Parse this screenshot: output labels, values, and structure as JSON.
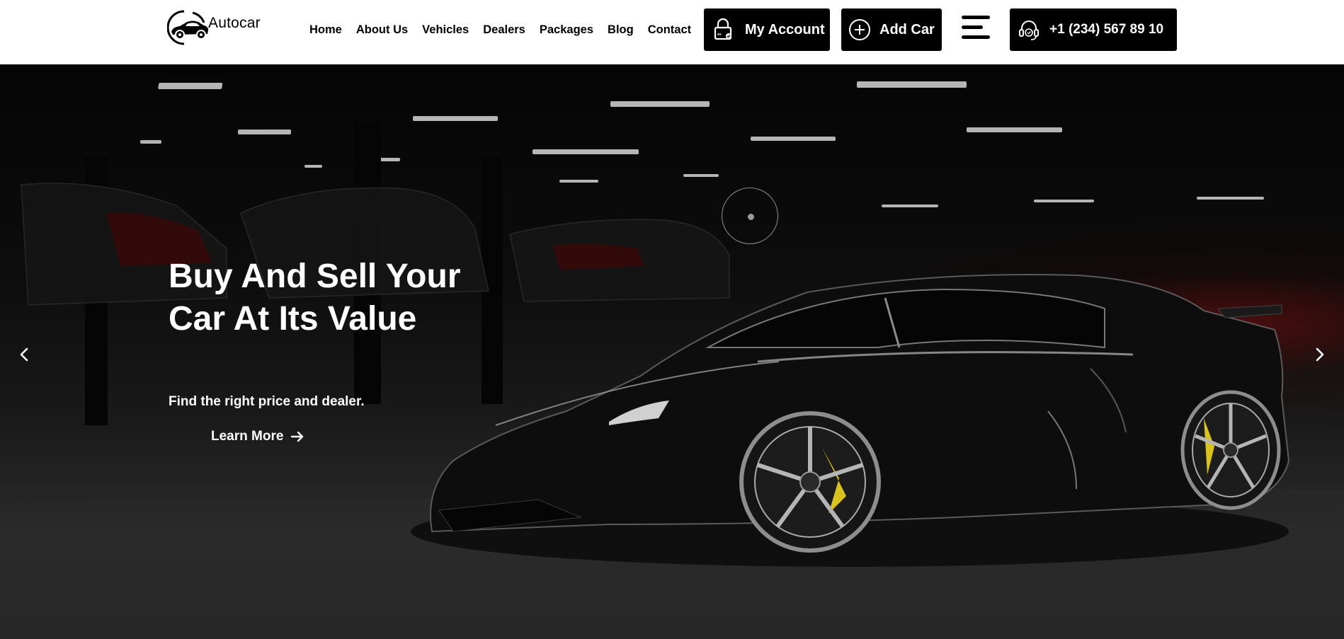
{
  "brand": {
    "name": "Autocar",
    "logo_icon": "car-logo-icon"
  },
  "nav": {
    "items": [
      {
        "label": "Home"
      },
      {
        "label": "About Us"
      },
      {
        "label": "Vehicles"
      },
      {
        "label": "Dealers"
      },
      {
        "label": "Packages"
      },
      {
        "label": "Blog"
      },
      {
        "label": "Contact"
      }
    ]
  },
  "header_actions": {
    "account": {
      "label": "My Account",
      "icon": "lock-icon"
    },
    "add_car": {
      "label": "Add Car",
      "icon": "plus-circle-icon"
    },
    "menu": {
      "icon": "hamburger-menu-icon"
    },
    "phone": {
      "label": "+1 (234) 567 89 10",
      "icon": "headset-icon"
    }
  },
  "hero": {
    "title_line1": "Buy And Sell Your",
    "title_line2": "Car At Its Value",
    "subtitle": "Find the right price and dealer.",
    "cta": {
      "label": "Learn More",
      "icon": "arrow-right-icon"
    },
    "prev_icon": "chevron-left-icon",
    "next_icon": "chevron-right-icon",
    "play_icon": "play-circle-icon"
  },
  "colors": {
    "header_bg": "#ffffff",
    "button_bg": "#000000",
    "hero_bg": "#0a0a0a",
    "accent_red": "#7a0a0a",
    "text_light": "#ffffff"
  }
}
